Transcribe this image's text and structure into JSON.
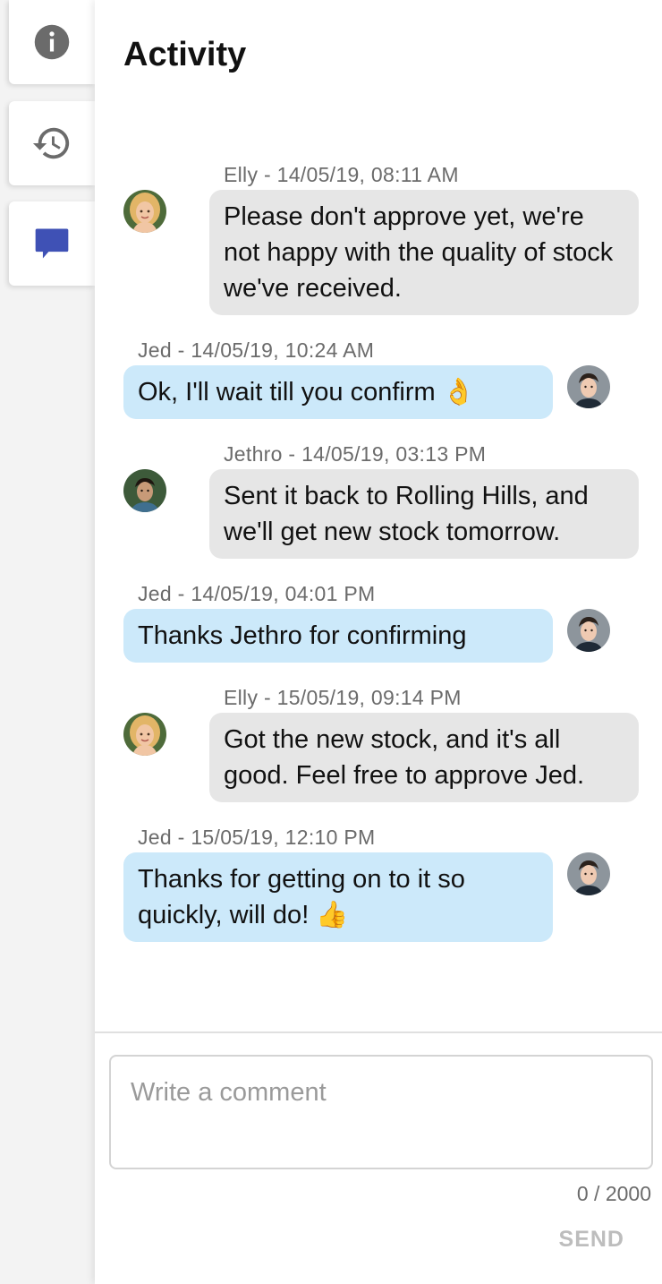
{
  "sidebar": {
    "tabs": [
      {
        "icon": "info-icon"
      },
      {
        "icon": "history-icon"
      },
      {
        "icon": "comment-icon",
        "active": true
      }
    ],
    "active_color": "#3f51b5",
    "icon_color": "#6b6b6b"
  },
  "header": {
    "title": "Activity"
  },
  "messages": [
    {
      "author": "Elly",
      "meta": "Elly - 14/05/19, 08:11 AM",
      "text": "Please don't approve yet, we're not happy with the quality of stock we've received.",
      "direction": "in",
      "avatar": "avatar-elly"
    },
    {
      "author": "Jed",
      "meta": "Jed - 14/05/19, 10:24 AM",
      "text": "Ok, I'll wait till you confirm 👌",
      "direction": "out",
      "avatar": "avatar-jed"
    },
    {
      "author": "Jethro",
      "meta": "Jethro - 14/05/19, 03:13 PM",
      "text": "Sent it back to Rolling Hills, and we'll get new stock tomorrow.",
      "direction": "in",
      "avatar": "avatar-jethro"
    },
    {
      "author": "Jed",
      "meta": "Jed - 14/05/19, 04:01 PM",
      "text": "Thanks Jethro for confirming",
      "direction": "out",
      "avatar": "avatar-jed"
    },
    {
      "author": "Elly",
      "meta": "Elly - 15/05/19, 09:14 PM",
      "text": "Got the new stock, and it's all good. Feel free to approve Jed.",
      "direction": "in",
      "avatar": "avatar-elly"
    },
    {
      "author": "Jed",
      "meta": "Jed - 15/05/19, 12:10 PM",
      "text": "Thanks for getting on to it so quickly, will do! 👍",
      "direction": "out",
      "avatar": "avatar-jed"
    }
  ],
  "colors": {
    "incoming_bubble": "#e6e6e6",
    "outgoing_bubble": "#cce9fa"
  },
  "composer": {
    "placeholder": "Write a comment",
    "value": "",
    "counter": "0 / 2000",
    "send_label": "SEND"
  }
}
